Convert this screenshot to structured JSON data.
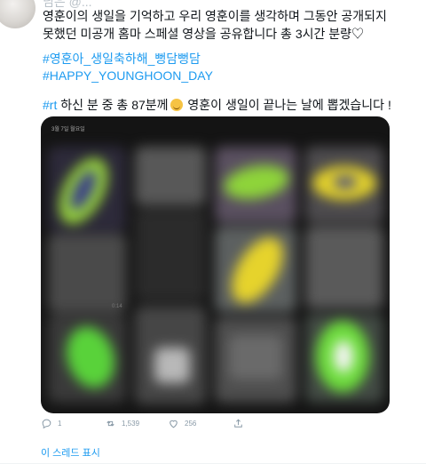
{
  "tweet": {
    "header": "님은 @...",
    "text": "영훈이의 생일을 기억하고 우리 영훈이를 생각하며 그동안 공개되지 못했던 미공개 홈마 스페셜 영상을 공유합니다 총 3시간 분량♡",
    "hashtags": [
      "#영훈아_생일축하해_뻥담뻥담",
      "#HAPPY_YOUNGHOON_DAY"
    ],
    "rt_tag": "#rt",
    "rt_text_before": " 하신 분 중 총 87분께",
    "rt_text_after": " 영훈이 생일이 끝나는 날에 뽑겠습니다 !",
    "emoji_icon": "party-face-emoji"
  },
  "media": {
    "timestamp": "3월 7일 월요일",
    "counter": "0:14"
  },
  "actions": {
    "reply_count": "1",
    "retweet_count": "1,539",
    "like_count": "256"
  },
  "thread_link": "이 스레드 표시",
  "colors": {
    "accent": "#1d9bf0",
    "muted": "#8899a6",
    "highlight_green": "#7ee04a",
    "highlight_yellow": "#e0d12a"
  }
}
